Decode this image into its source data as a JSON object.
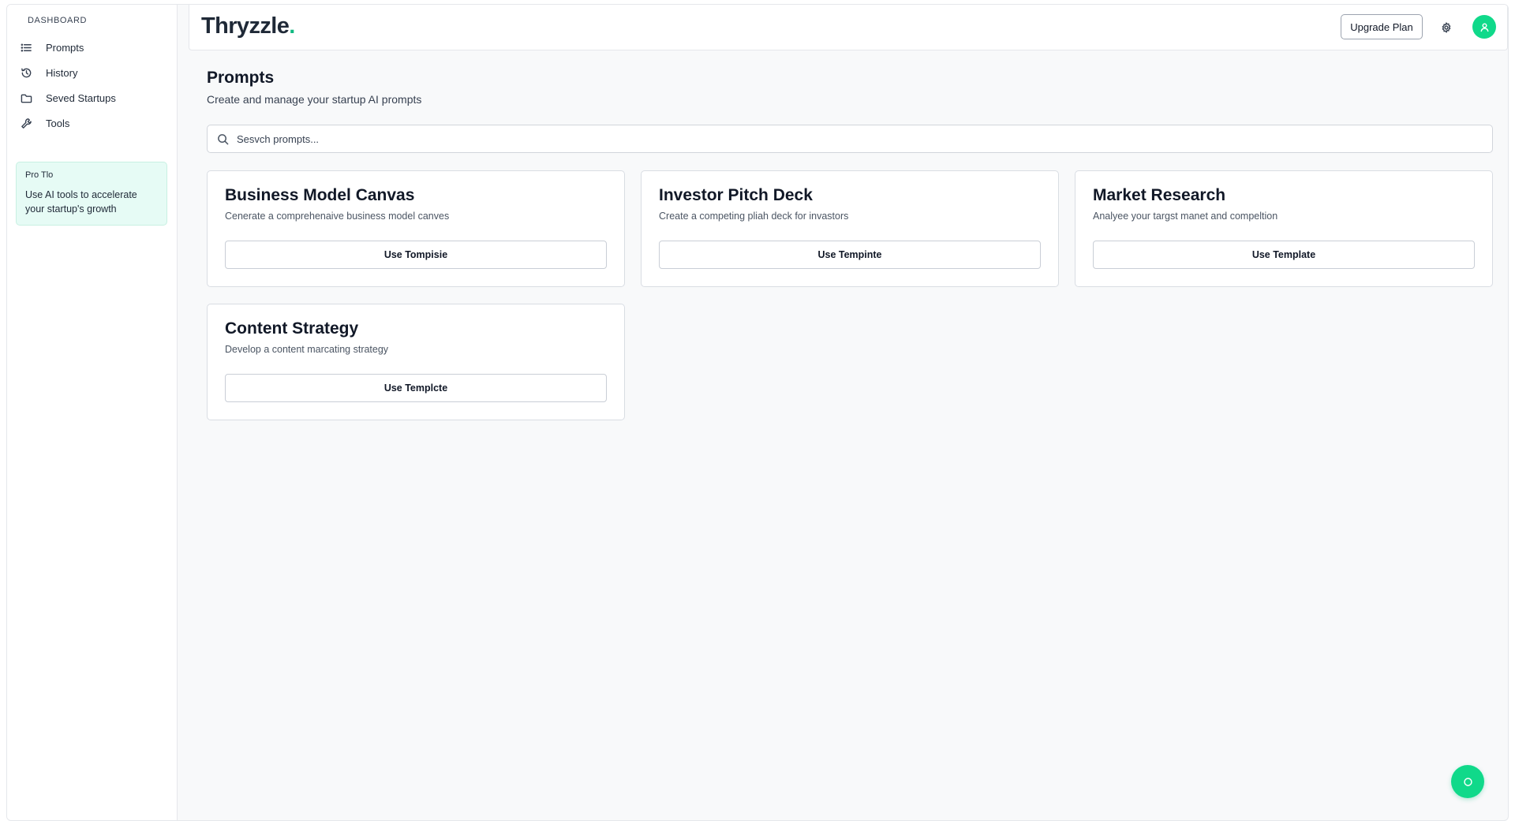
{
  "sidebar": {
    "heading": "DASHBOARD",
    "items": [
      {
        "label": "Prompts",
        "icon": "list-icon"
      },
      {
        "label": "History",
        "icon": "history-icon"
      },
      {
        "label": "Seved Startups",
        "icon": "folder-icon"
      },
      {
        "label": "Tools",
        "icon": "wrench-icon"
      }
    ],
    "protip": {
      "title": "Pro Tlo",
      "text": "Use AI tools to accelerate your startup's growth"
    }
  },
  "header": {
    "logo_main": "Thryzzle",
    "logo_dot": ".",
    "upgrade_label": "Upgrade Plan",
    "accent_color": "#10b981"
  },
  "main": {
    "title": "Prompts",
    "subtitle": "Create and manage your startup AI prompts",
    "search_placeholder": "Sesvch prompts...",
    "cards": [
      {
        "title": "Business Model Canvas",
        "description": "Cenerate a comprehenaive business model canves",
        "button": "Use Tompisie"
      },
      {
        "title": "Investor Pitch Deck",
        "description": "Create a competing pliah deck for invastors",
        "button": "Use Tempinte"
      },
      {
        "title": "Market Research",
        "description": "Analyee your targst manet and compeltion",
        "button": "Use Template"
      },
      {
        "title": "Content Strategy",
        "description": "Develop a content marcating strategy",
        "button": "Use Templcte"
      }
    ]
  }
}
